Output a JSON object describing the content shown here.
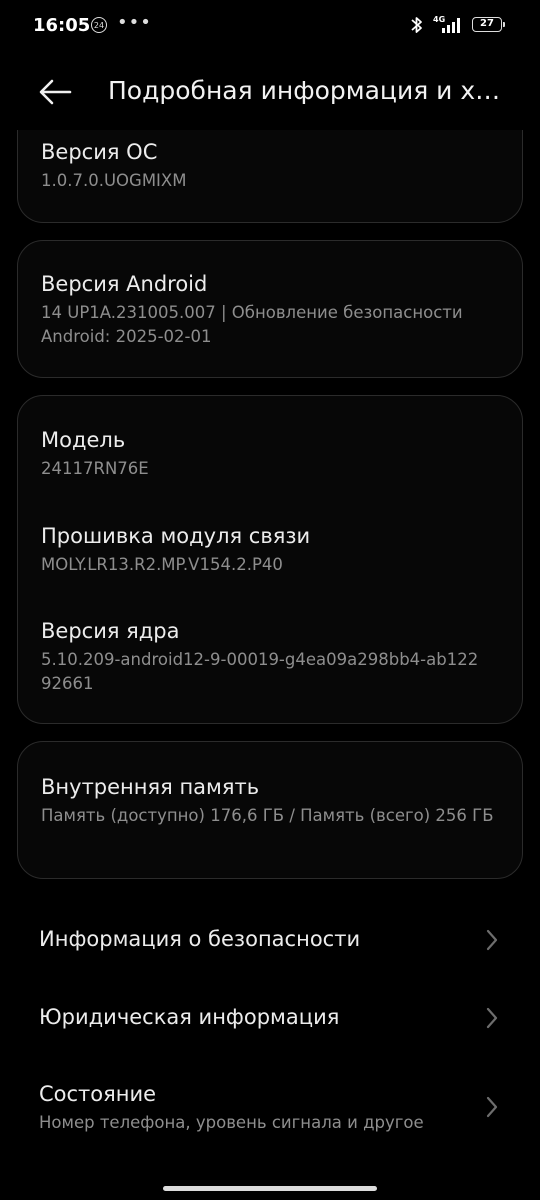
{
  "status": {
    "time": "16:05",
    "notification_count": "24",
    "more": "•••",
    "network": "4G",
    "battery": "27"
  },
  "header": {
    "title": "Подробная информация и х…"
  },
  "os_version": {
    "title": "Версия ОС",
    "value": "1.0.7.0.UOGMIXM"
  },
  "android_version": {
    "title": "Версия Android",
    "value": "14 UP1A.231005.007 | Обновление безопасности Android: 2025-02-01"
  },
  "model": {
    "title": "Модель",
    "value": "24117RN76E"
  },
  "baseband": {
    "title": "Прошивка модуля связи",
    "value": "MOLY.LR13.R2.MP.V154.2.P40"
  },
  "kernel": {
    "title": "Версия ядра",
    "value": "5.10.209-android12-9-00019-g4ea09a298bb4-ab122 92661"
  },
  "storage": {
    "title": "Внутренняя память",
    "value": "Память (доступно)  176,6 ГБ / Память (всего) 256 ГБ"
  },
  "menu": {
    "security_info": "Информация о безопасности",
    "legal_info": "Юридическая информация",
    "status_title": "Состояние",
    "status_subtitle": "Номер телефона, уровень сигнала и другое"
  },
  "icons": {
    "back": "arrow-left-icon",
    "chevron": "chevron-right-icon",
    "bluetooth": "bluetooth-icon",
    "signal": "signal-icon",
    "battery": "battery-icon"
  }
}
